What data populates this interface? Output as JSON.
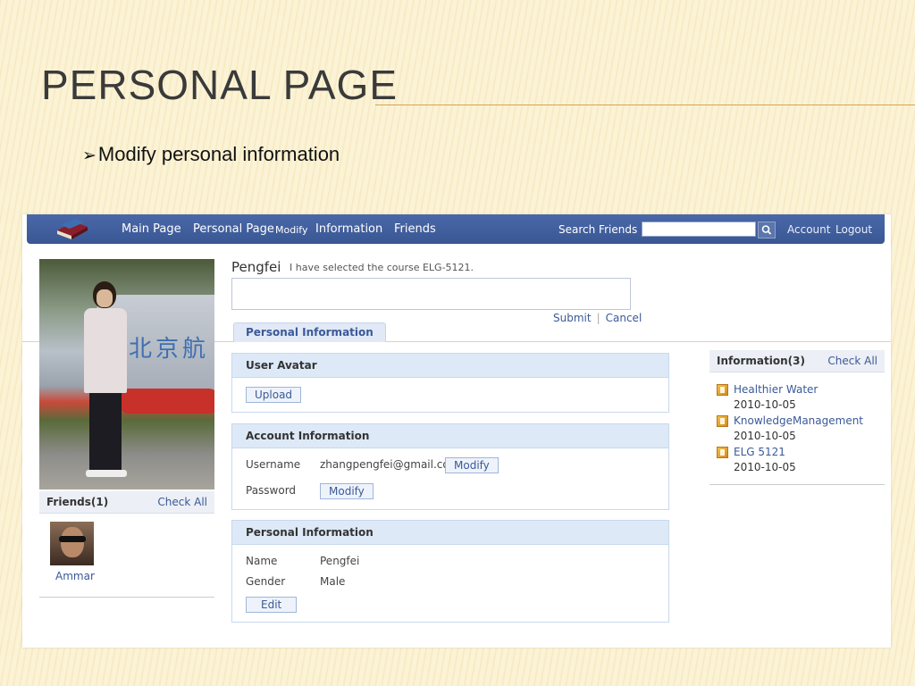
{
  "slide": {
    "title": "PERSONAL PAGE",
    "bullet": "Modify personal information",
    "bullet_marker": "➢"
  },
  "navbar": {
    "main_page": "Main Page",
    "personal_page": "Personal Page",
    "modify": "Modify",
    "information": "Information",
    "friends": "Friends",
    "search_label": "Search Friends",
    "search_value": "",
    "account": "Account",
    "logout": "Logout"
  },
  "friends_box": {
    "title": "Friends(1)",
    "check_all": "Check All",
    "friends": [
      {
        "name": "Ammar"
      }
    ]
  },
  "status": {
    "name": "Pengfei",
    "text": "I have selected the course ELG-5121.",
    "input_value": "",
    "submit": "Submit",
    "separator": "|",
    "cancel": "Cancel"
  },
  "tab": {
    "label": "Personal Information"
  },
  "avatar_panel": {
    "title": "User Avatar",
    "upload": "Upload"
  },
  "account_panel": {
    "title": "Account Information",
    "username_label": "Username",
    "username_value": "zhangpengfei@gmail.com",
    "modify": "Modify",
    "password_label": "Password",
    "password_modify": "Modify"
  },
  "personal_panel": {
    "title": "Personal Information",
    "name_label": "Name",
    "name_value": "Pengfei",
    "gender_label": "Gender",
    "gender_value": "Male",
    "edit": "Edit"
  },
  "info_box": {
    "title": "Information(3)",
    "check_all": "Check All",
    "items": [
      {
        "title": "Healthier Water",
        "date": "2010-10-05"
      },
      {
        "title": "KnowledgeManagement",
        "date": "2010-10-05"
      },
      {
        "title": "ELG 5121",
        "date": "2010-10-05"
      }
    ]
  },
  "colors": {
    "navbar": "#3b5998",
    "link": "#3b5998",
    "panel_header": "#dde9f7"
  }
}
